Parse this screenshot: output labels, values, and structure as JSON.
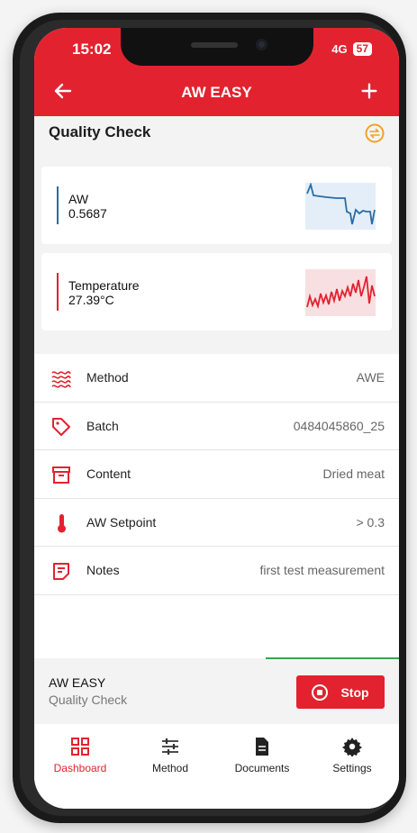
{
  "status": {
    "time": "15:02",
    "network": "4G",
    "battery": "57"
  },
  "appbar": {
    "title": "AW EASY"
  },
  "section": {
    "title": "Quality Check"
  },
  "cards": [
    {
      "label": "AW",
      "value": "0.5687",
      "color": "#2b6ca3"
    },
    {
      "label": "Temperature",
      "value": "27.39°C",
      "color": "#e3222f"
    }
  ],
  "details": [
    {
      "icon": "waves-icon",
      "name": "Method",
      "value": "AWE"
    },
    {
      "icon": "tag-icon",
      "name": "Batch",
      "value": "0484045860_25"
    },
    {
      "icon": "archive-box-icon",
      "name": "Content",
      "value": "Dried meat"
    },
    {
      "icon": "thermometer-icon",
      "name": "AW Setpoint",
      "value": "> 0.3"
    },
    {
      "icon": "notes-icon",
      "name": "Notes",
      "value": "first test measurement"
    }
  ],
  "footer": {
    "line1": "AW EASY",
    "line2": "Quality Check",
    "stop_label": "Stop"
  },
  "nav": [
    {
      "label": "Dashboard",
      "icon": "grid-icon",
      "active": true
    },
    {
      "label": "Method",
      "icon": "sliders-icon",
      "active": false
    },
    {
      "label": "Documents",
      "icon": "document-icon",
      "active": false
    },
    {
      "label": "Settings",
      "icon": "gear-icon",
      "active": false
    }
  ],
  "colors": {
    "accent": "#e3222f",
    "aw_line": "#2b6ca3",
    "progress": "#3ea34c"
  }
}
